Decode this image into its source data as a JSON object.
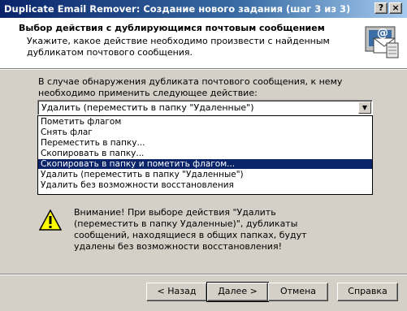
{
  "window": {
    "title": "Duplicate Email Remover: Создание нового задания (шаг 3 из 3)",
    "help_glyph": "?",
    "close_glyph": "×"
  },
  "header": {
    "title": "Выбор действия с дублирующимся почтовым сообщением",
    "description": "Укажите, какое действие необходимо произвести с найденным дубликатом почтового сообщения."
  },
  "main": {
    "prompt": "В случае обнаружения дубликата почтового сообщения, к нему необходимо применить следующее действие:",
    "action_select": {
      "selected": "Удалить (переместить в папку \"Удаленные\")",
      "options": [
        "Пометить флагом",
        "Снять флаг",
        "Переместить в папку...",
        "Скопировать в папку...",
        "Скопировать в папку и пометить флагом...",
        "Удалить (переместить в папку \"Удаленные\")",
        "Удалить без возможности восстановления"
      ],
      "highlighted_index": 4
    },
    "warning": "Внимание! При выборе действия \"Удалить (переместить в папку Удаленные)\", дубликаты сообщений, находящиеся в общих папках, будут удалены без возможности восстановления!"
  },
  "footer": {
    "back_label": "< Назад",
    "next_label": "Далее >",
    "cancel_label": "Отмена",
    "help_label": "Справка"
  },
  "colors": {
    "title_bar": "#0a246a",
    "selection": "#0a246a",
    "dialog_bg": "#d4d0c8"
  },
  "icons": {
    "header": "email-envelope-icon",
    "warning": "warning-triangle-icon"
  }
}
